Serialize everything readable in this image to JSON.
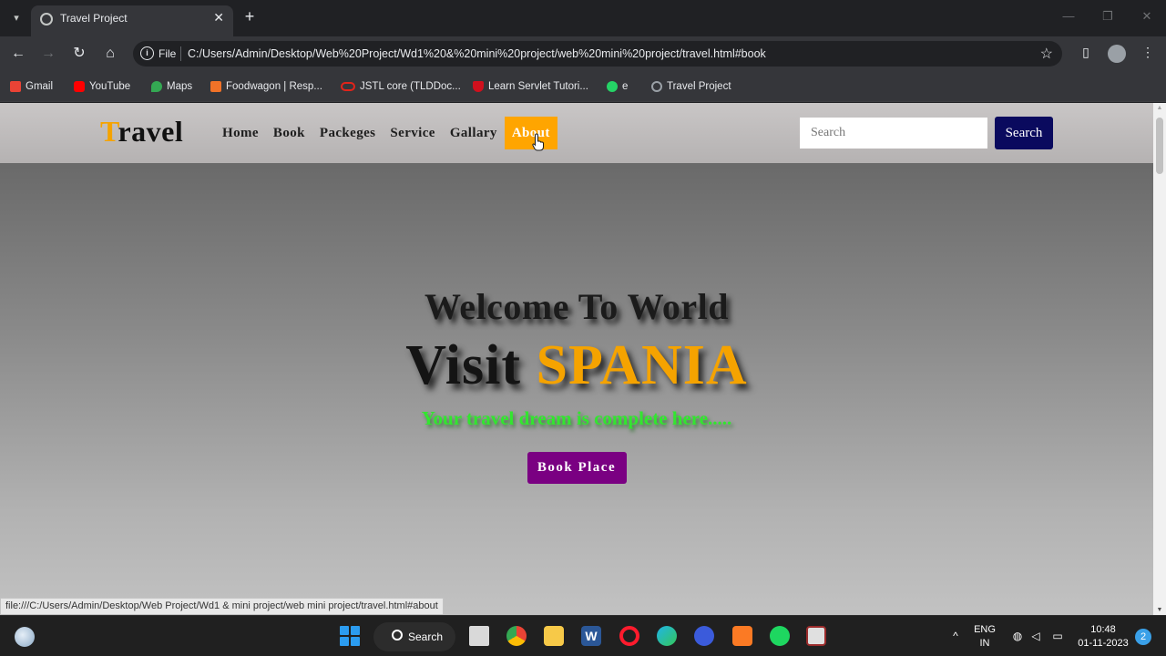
{
  "browser": {
    "tab_title": "Travel Project",
    "omnibox_scheme": "File",
    "omnibox_url": "C:/Users/Admin/Desktop/Web%20Project/Wd1%20&%20mini%20project/web%20mini%20project/travel.html#book",
    "bookmarks": [
      {
        "label": "Gmail",
        "icon": "gmail-icon",
        "color": "#ea4335"
      },
      {
        "label": "YouTube",
        "icon": "youtube-icon",
        "color": "#ff0000"
      },
      {
        "label": "Maps",
        "icon": "maps-icon",
        "color": "#34a853"
      },
      {
        "label": "Foodwagon | Resp...",
        "icon": "foodwagon-icon",
        "color": "#f17228"
      },
      {
        "label": "JSTL core (TLDDoc...",
        "icon": "oracle-icon",
        "color": "#e2231a"
      },
      {
        "label": "Learn Servlet Tutori...",
        "icon": "servlet-icon",
        "color": "#d0101d"
      },
      {
        "label": "e",
        "icon": "whatsapp-icon",
        "color": "#25d366"
      },
      {
        "label": "Travel Project",
        "icon": "globe-icon",
        "color": "#9aa0a6"
      }
    ]
  },
  "site": {
    "logo_first": "T",
    "logo_rest": "ravel",
    "menu": [
      "Home",
      "Book",
      "Packeges",
      "Service",
      "Gallary",
      "About"
    ],
    "active_menu": "About",
    "search_placeholder": "Search",
    "search_button": "Search",
    "colors": {
      "accent": "#ffa500",
      "search_button": "#0a0a5e",
      "book_button": "#7a0082",
      "tagline": "#32e62f"
    }
  },
  "hero": {
    "welcome": "Welcome To World",
    "visit_word": "Visit",
    "brand": "SPANIA",
    "tagline": "Your travel dream is complete here.....",
    "book_button": "Book Place"
  },
  "status_bar_url": "file:///C:/Users/Admin/Desktop/Web Project/Wd1 & mini project/web mini project/travel.html#about",
  "taskbar": {
    "search_label": "Search",
    "language_top": "ENG",
    "language_bottom": "IN",
    "time": "10:48",
    "date": "01-11-2023",
    "notification_count": "2"
  }
}
